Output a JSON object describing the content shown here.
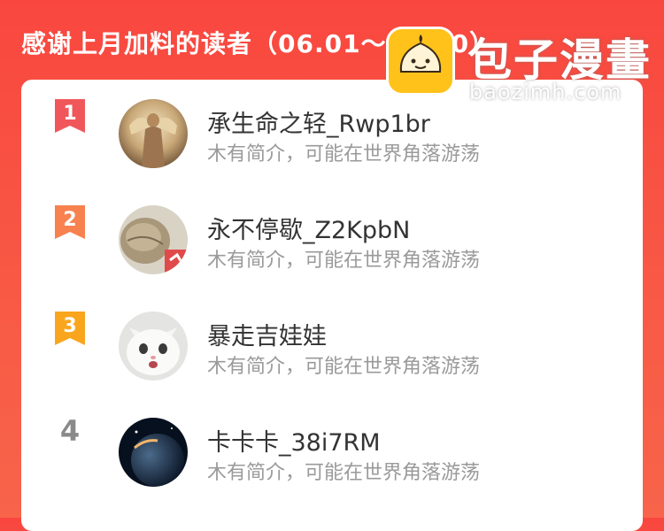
{
  "header": {
    "title": "感谢上月加料的读者（06.01～06.30）"
  },
  "readers": [
    {
      "rank": "1",
      "name": "承生命之轻_Rwp1br",
      "bio": "木有简介，可能在世界角落游荡",
      "badge_color": "#f0575b",
      "avatar_icon": "angel-statue-avatar"
    },
    {
      "rank": "2",
      "name": "永不停歇_Z2KpbN",
      "bio": "木有简介，可能在世界角落游荡",
      "badge_color": "#f7814f",
      "avatar_icon": "rock-avatar"
    },
    {
      "rank": "3",
      "name": "暴走吉娃娃",
      "bio": "木有简介，可能在世界角落游荡",
      "badge_color": "#f9a61e",
      "avatar_icon": "white-cat-avatar"
    },
    {
      "rank": "4",
      "name": "卡卡卡_38i7RM",
      "bio": "木有简介，可能在世界角落游荡",
      "avatar_icon": "planet-avatar"
    }
  ],
  "watermark": {
    "name": "包子漫畫",
    "url": "baozimh.com",
    "icon": "bun-logo-icon"
  },
  "colors": {
    "header_bg": "#f9473f",
    "card_bg": "#ffffff",
    "name_text": "#333333",
    "bio_text": "#9a9a9a"
  }
}
